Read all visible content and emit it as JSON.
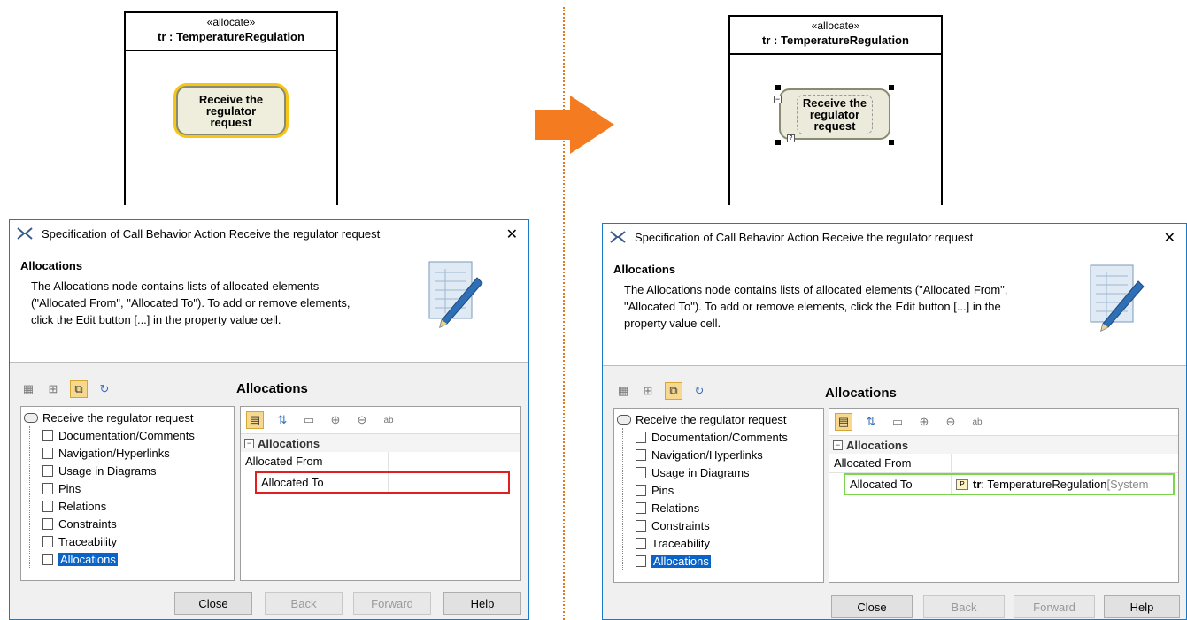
{
  "left": {
    "swimlane": {
      "stereotype": "«allocate»",
      "name": "tr : TemperatureRegulation"
    },
    "action": {
      "line1": "Receive the",
      "line2": "regulator",
      "line3": "request"
    },
    "dialog": {
      "title": "Specification of Call Behavior Action Receive the regulator request",
      "close_glyph": "✕",
      "header_title": "Allocations",
      "header_lines": [
        "The Allocations node contains lists of allocated elements",
        "(\"Allocated From\", \"Allocated To\"). To add or remove elements,",
        "click the Edit button [...] in the property value cell."
      ],
      "section_title": "Allocations",
      "tree_root": "Receive the regulator request",
      "tree_items": [
        "Documentation/Comments",
        "Navigation/Hyperlinks",
        "Usage in Diagrams",
        "Pins",
        "Relations",
        "Constraints",
        "Traceability",
        "Allocations"
      ],
      "group": "Allocations",
      "rows": [
        {
          "name": "Allocated From",
          "value": ""
        },
        {
          "name": "Allocated To",
          "value": ""
        }
      ],
      "buttons": {
        "close": "Close",
        "back": "Back",
        "forward": "Forward",
        "help": "Help"
      }
    }
  },
  "right": {
    "swimlane": {
      "stereotype": "«allocate»",
      "name": "tr : TemperatureRegulation"
    },
    "action": {
      "line1": "Receive the",
      "line2": "regulator",
      "line3": "request"
    },
    "dialog": {
      "title": "Specification of Call Behavior Action Receive the regulator request",
      "close_glyph": "✕",
      "header_title": "Allocations",
      "header_lines": [
        "The Allocations node contains lists of allocated elements (\"Allocated From\",",
        "\"Allocated To\"). To add or remove elements, click the Edit button [...] in the",
        "property value cell."
      ],
      "section_title": "Allocations",
      "tree_root": "Receive the regulator request",
      "tree_items": [
        "Documentation/Comments",
        "Navigation/Hyperlinks",
        "Usage in Diagrams",
        "Pins",
        "Relations",
        "Constraints",
        "Traceability",
        "Allocations"
      ],
      "group": "Allocations",
      "rows": [
        {
          "name": "Allocated From",
          "value": ""
        },
        {
          "name": "Allocated To",
          "value_bold": "tr",
          "value_rest": " : TemperatureRegulation",
          "value_scope": " [System"
        }
      ],
      "buttons": {
        "close": "Close",
        "back": "Back",
        "forward": "Forward",
        "help": "Help"
      }
    }
  },
  "colors": {
    "arrow": "#f47b20",
    "selection": "#0a64c8",
    "title_border": "#1979ca",
    "highlight_red": "#e02020",
    "highlight_green": "#7ad64a",
    "toggle_on": "#f6d98e"
  }
}
